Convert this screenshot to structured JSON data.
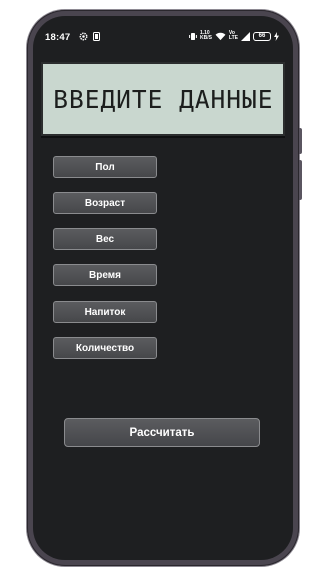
{
  "status_bar": {
    "time": "18:47",
    "net_speed_value": "1.10",
    "net_speed_unit": "KB/S",
    "volte_top": "Vo",
    "volte_bottom": "LTE",
    "battery": "66"
  },
  "display": {
    "text": "ВВЕДИТЕ ДАННЫЕ"
  },
  "inputs": [
    {
      "label": "Пол"
    },
    {
      "label": "Возраст"
    },
    {
      "label": "Вес"
    },
    {
      "label": "Время"
    },
    {
      "label": "Напиток"
    },
    {
      "label": "Количество"
    }
  ],
  "calculate_label": "Рассчитать",
  "colors": {
    "screen_bg": "#1e1f21",
    "display_bg": "#c9d7cf",
    "button_bg": "#505154",
    "button_border": "#8a8b8e"
  }
}
